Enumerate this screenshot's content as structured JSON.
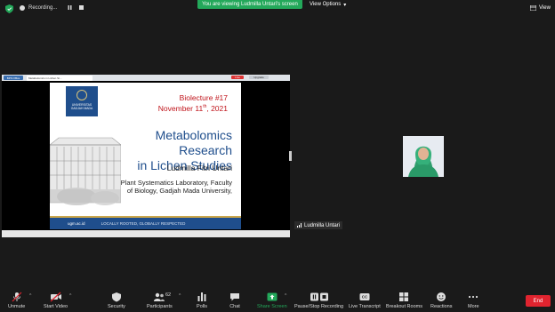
{
  "top": {
    "recording_label": "Recording...",
    "viewing_banner": "You are viewing Ludmilla Untari's screen",
    "view_options": "View Options",
    "view": "View"
  },
  "browser": {
    "left_tab": "BPS Office",
    "active_tab": "Metabolomics in Lichen St...",
    "red_tab": "Live",
    "gray_tab": "Upgrade"
  },
  "slide": {
    "logo_text": "UNIVERSITAS GADJAH MADA",
    "lecture": "Biolecture #17",
    "date_main": "November 11",
    "date_sup": "th",
    "date_year": ", 2021",
    "title_line1": "Metabolomics Research",
    "title_line2": "in Lichen Studies",
    "author": "Ludmilla Fitri Untari",
    "affil_line1": "Plant Systematics Laboratory, Faculty",
    "affil_line2": "of Biology, Gadjah Mada University,",
    "footer_web": "ugm.ac.id",
    "footer_tag": "LOCALLY ROOTED, GLOBALLY RESPECTED"
  },
  "participant": {
    "name": "Ludmilla Untari"
  },
  "toolbar": {
    "unmute": "Unmute",
    "start_video": "Start Video",
    "security": "Security",
    "participants": "Participants",
    "participants_count": "62",
    "polls": "Polls",
    "chat": "Chat",
    "share_screen": "Share Screen",
    "pause_recording": "Pause/Stop Recording",
    "live_transcript": "Live Transcript",
    "breakout_rooms": "Breakout Rooms",
    "reactions": "Reactions",
    "more": "More",
    "end": "End",
    "colors": {
      "share": "#23a85a",
      "end": "#e0242f"
    }
  }
}
